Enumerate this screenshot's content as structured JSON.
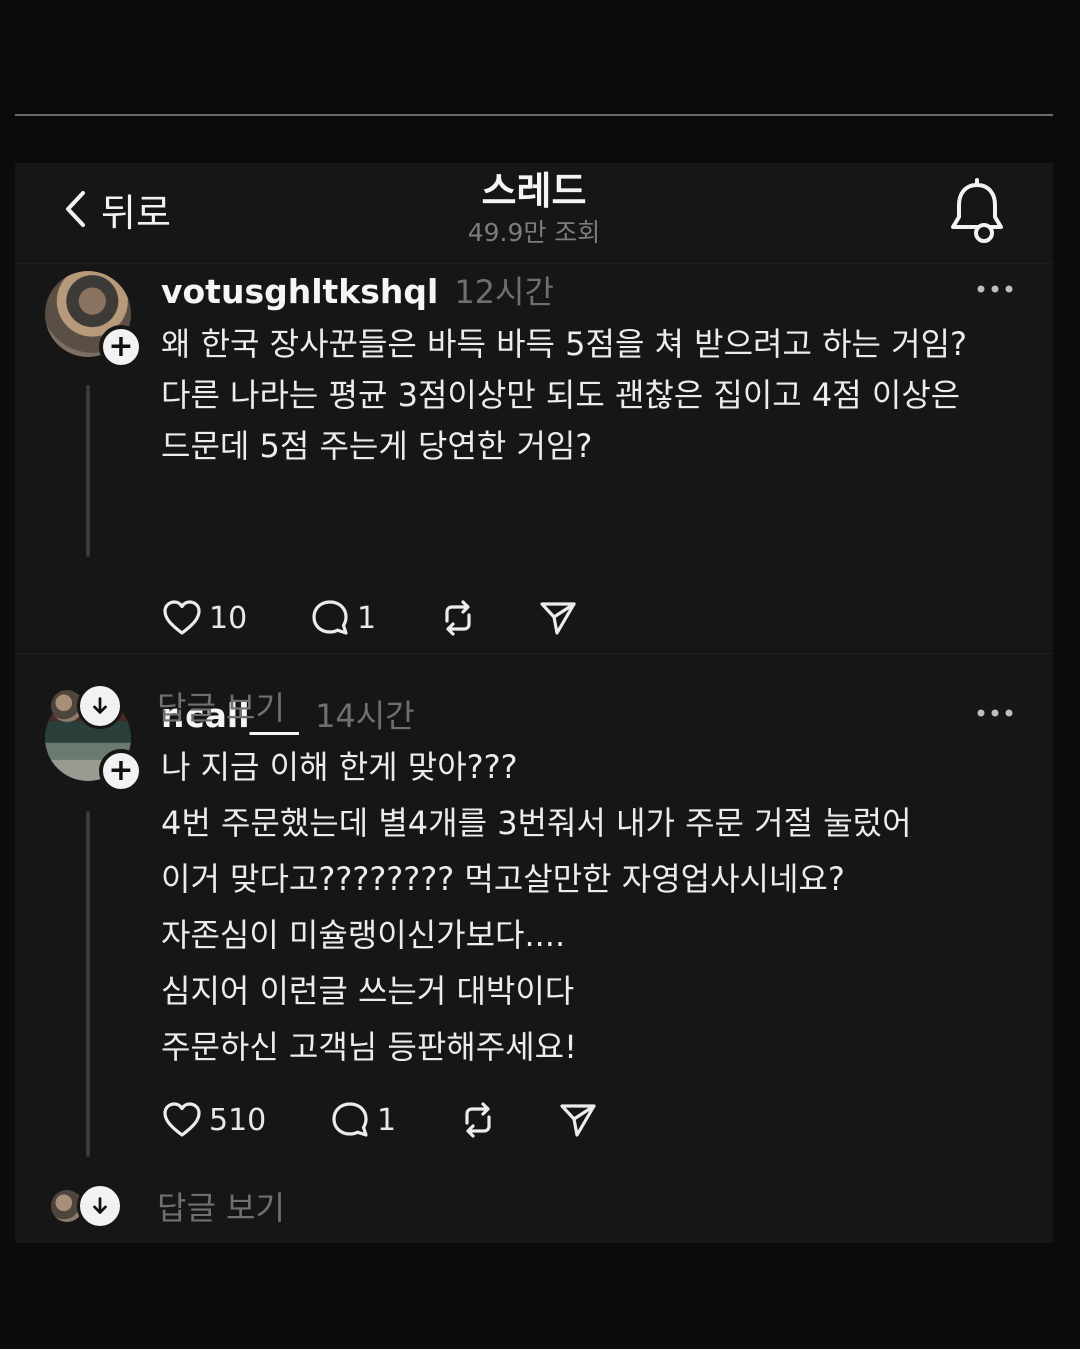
{
  "header": {
    "back_label": "뒤로",
    "title": "스레드",
    "views": "49.9만 조회"
  },
  "posts": [
    {
      "username": "votusghltkshql",
      "time": "12시간",
      "lines": [
        "왜 한국 장사꾼들은 바득 바득 5점을 쳐 받으려고 하는 거임?",
        "다른 나라는 평균 3점이상만 되도 괜찮은 집이고 4점 이상은",
        "드문데 5점 주는게 당연한 거임?"
      ],
      "likes": "10",
      "replies": "1",
      "view_replies": "답글 보기"
    },
    {
      "username": "r.call___",
      "time": "14시간",
      "lines": [
        "나 지금 이해 한게 맞아???",
        "4번 주문했는데 별4개를 3번줘서 내가 주문 거절 눌렀어",
        "이거 맞다고???????? 먹고살만한 자영업사시네요?",
        "자존심이 미슐랭이신가보다....",
        "심지어 이런글 쓰는거 대박이다",
        "주문하신 고객님 등판해주세요!"
      ],
      "likes": "510",
      "replies": "1",
      "view_replies": "답글 보기"
    }
  ],
  "icons": {
    "back": "chevron-left-icon",
    "bell": "bell-icon",
    "more": "more-horizontal-icon",
    "like": "heart-icon",
    "reply": "comment-icon",
    "repost": "repost-icon",
    "share": "send-icon",
    "follow": "plus-icon",
    "expand": "arrow-down-icon"
  }
}
